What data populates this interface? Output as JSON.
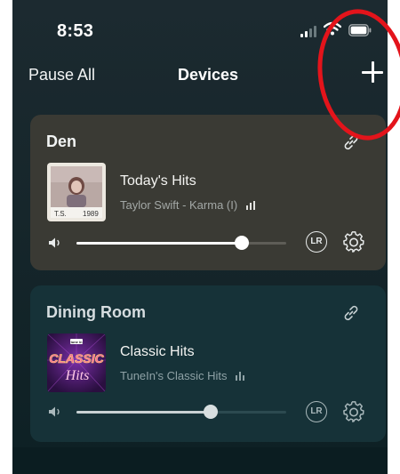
{
  "status_bar": {
    "time": "8:53",
    "signal_icon": "cellular-signal-icon",
    "wifi_icon": "wifi-icon",
    "battery_icon": "battery-icon"
  },
  "nav": {
    "left_label": "Pause All",
    "title": "Devices",
    "add_icon": "plus-icon"
  },
  "devices": [
    {
      "room": "Den",
      "station": "Today's Hits",
      "now_playing": "Taylor Swift - Karma (I)",
      "album_art_text": [
        "T.S.",
        "1989"
      ],
      "volume": 0.79,
      "lr_label": "LR",
      "card_color": "#3a3a34"
    },
    {
      "room": "Dining Room",
      "station": "Classic Hits",
      "now_playing": "TuneIn's Classic Hits",
      "album_art_text": [
        "tune in",
        "CLASSIC",
        "Hits"
      ],
      "volume": 0.64,
      "lr_label": "LR",
      "card_color": "#163238"
    }
  ],
  "colors": {
    "background": "#16262b",
    "annotation": "#e3141b",
    "slider_fill": "#ffffff"
  }
}
